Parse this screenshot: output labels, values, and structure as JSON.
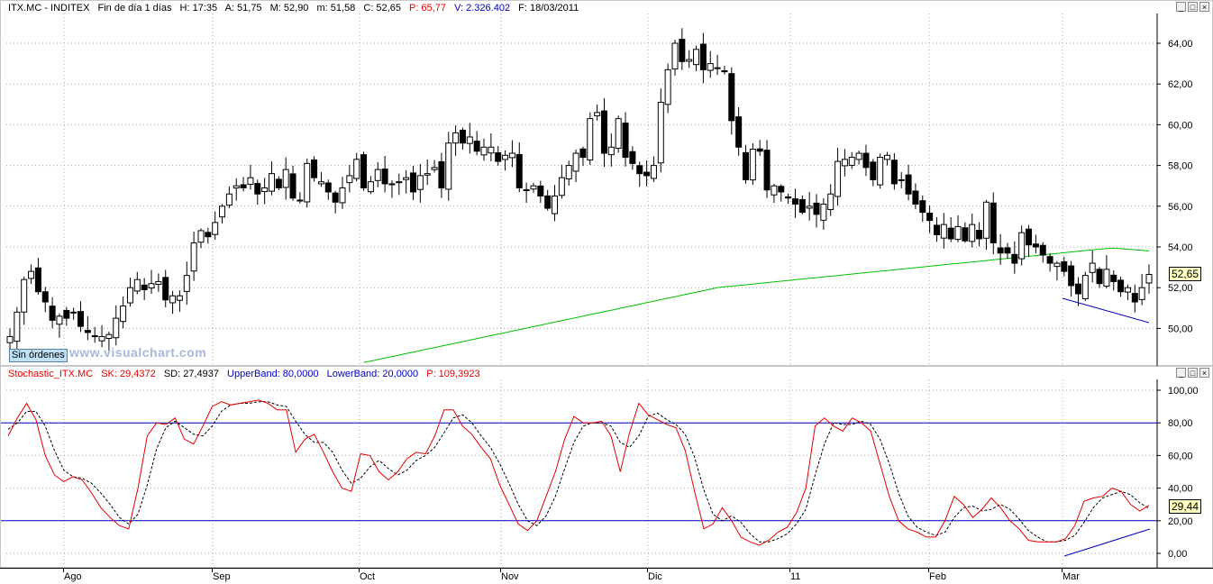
{
  "price_header": {
    "symbol": "ITX.MC - INDITEX",
    "period": "Fin de día 1 días",
    "h": "H: 17:35",
    "a": "A: 51,75",
    "m": "M: 52,90",
    "min": "m: 51,58",
    "c": "C: 52,65",
    "p": "P: 65,77",
    "v": "V: 2.326.402",
    "f": "F: 18/03/2011"
  },
  "stoch_header": {
    "name": "Stochastic_ITX.MC",
    "sk": "SK: 29,4372",
    "sd": "SD: 27,4937",
    "upper": "UpperBand: 80,0000",
    "lower": "LowerBand: 20,0000",
    "p": "P: 109,3923"
  },
  "window_buttons": {
    "min": "_",
    "max": "□",
    "close": "×"
  },
  "sin_ordenes": "Sin órdenes",
  "watermark": "www.visualchart.com",
  "last_price": "52,65",
  "last_stoch": "29,44",
  "price_axis": [
    "64,00",
    "62,00",
    "60,00",
    "58,00",
    "56,00",
    "54,00",
    "52,00",
    "50,00"
  ],
  "stoch_axis": [
    "100,00",
    "80,00",
    "60,00",
    "40,00",
    "20,00",
    "0,00"
  ],
  "months": [
    "Ago",
    "Sep",
    "Oct",
    "Nov",
    "Dic",
    "11",
    "Feb",
    "Mar"
  ],
  "colors": {
    "ma": "#00c000",
    "sk": "#e00000",
    "sd": "#000000",
    "band": "#0000c0",
    "trend": "#0000c0"
  },
  "chart_data": [
    {
      "type": "candlestick",
      "title": "ITX.MC - INDITEX",
      "ylim": [
        48.2,
        65.0
      ],
      "x": [
        "Ago",
        "Sep",
        "Oct",
        "Nov",
        "Dic",
        "11",
        "Feb",
        "Mar"
      ],
      "close": [
        49.6,
        50.8,
        52.4,
        52.8,
        51.8,
        51.3,
        50.4,
        50.6,
        50.5,
        50.8,
        50.1,
        49.8,
        49.6,
        49.6,
        49.7,
        50.5,
        51.1,
        52.0,
        52.4,
        51.9,
        52.2,
        52.3,
        51.4,
        51.6,
        51.6,
        52.6,
        54.2,
        54.8,
        54.5,
        55.2,
        56.0,
        56.6,
        57.0,
        56.9,
        57.4,
        56.6,
        56.9,
        57.6,
        56.9,
        57.8,
        56.4,
        56.3,
        58.1,
        57.4,
        57.2,
        56.7,
        56.2,
        56.9,
        57.5,
        58.3,
        56.9,
        57.2,
        57.8,
        57.1,
        57.1,
        57.2,
        57.4,
        56.7,
        57.5,
        57.6,
        57.9,
        56.9,
        59.1,
        59.6,
        59.1,
        59.4,
        58.7,
        58.9,
        58.9,
        58.2,
        58.5,
        58.6,
        56.9,
        56.8,
        57.0,
        56.5,
        55.9,
        56.5,
        57.4,
        58.0,
        58.6,
        58.4,
        60.3,
        60.6,
        58.6,
        58.9,
        60.3,
        58.4,
        58.1,
        57.6,
        57.5,
        58.0,
        61.1,
        62.7,
        64.0,
        63.1,
        63.2,
        63.7,
        62.7,
        63.0,
        62.8,
        62.6,
        60.2,
        58.9,
        57.3,
        58.8,
        58.7,
        56.8,
        57.0,
        56.7,
        56.4,
        56.1,
        55.7,
        56.0,
        55.6,
        56.1,
        56.6,
        58.2,
        58.3,
        58.4,
        58.6,
        57.9,
        57.3,
        58.4,
        58.5,
        57.1,
        57.3,
        56.6,
        56.1,
        55.7,
        55.3,
        54.6,
        55.1,
        54.4,
        55.0,
        54.3,
        55.1,
        54.4,
        56.2,
        54.2,
        53.7,
        53.7,
        53.2,
        54.7,
        54.1,
        54.0,
        53.6,
        53.2,
        53.2,
        52.8,
        52.1,
        51.7,
        52.6,
        53.2,
        52.2,
        52.9,
        52.3,
        51.8,
        52.0,
        51.3,
        52.0,
        52.65
      ]
    },
    {
      "type": "line",
      "title": "Stochastic_ITX.MC",
      "ylim": [
        -8,
        106
      ],
      "series": [
        {
          "name": "SK",
          "values": [
            72,
            83,
            92,
            82,
            60,
            48,
            44,
            47,
            45,
            37,
            28,
            22,
            17,
            15,
            40,
            72,
            80,
            79,
            83,
            70,
            67,
            78,
            90,
            93,
            91,
            92,
            93,
            94,
            92,
            88,
            88,
            62,
            70,
            73,
            62,
            50,
            40,
            38,
            61,
            60,
            50,
            45,
            50,
            58,
            62,
            61,
            72,
            88,
            88,
            78,
            73,
            65,
            58,
            42,
            30,
            18,
            14,
            20,
            35,
            50,
            70,
            84,
            80,
            80,
            81,
            72,
            50,
            74,
            92,
            85,
            82,
            79,
            77,
            63,
            38,
            15,
            18,
            28,
            20,
            10,
            7,
            5,
            8,
            13,
            16,
            25,
            40,
            78,
            83,
            78,
            75,
            83,
            80,
            75,
            55,
            35,
            20,
            15,
            13,
            10,
            10,
            20,
            35,
            30,
            22,
            27,
            34,
            28,
            20,
            15,
            8,
            7,
            7,
            7,
            9,
            17,
            32,
            34,
            35,
            40,
            38,
            30,
            26,
            29.4
          ]
        },
        {
          "name": "SD",
          "values": [
            76,
            80,
            87,
            87,
            78,
            63,
            51,
            47,
            46,
            43,
            37,
            30,
            22,
            18,
            24,
            42,
            64,
            77,
            81,
            77,
            73,
            72,
            78,
            87,
            91,
            92,
            92,
            93,
            93,
            91,
            90,
            81,
            73,
            68,
            68,
            62,
            51,
            43,
            46,
            53,
            57,
            52,
            48,
            51,
            57,
            60,
            65,
            74,
            83,
            85,
            80,
            72,
            65,
            55,
            43,
            30,
            20,
            17,
            23,
            35,
            52,
            68,
            78,
            80,
            80,
            78,
            68,
            65,
            72,
            84,
            86,
            82,
            79,
            73,
            59,
            39,
            24,
            20,
            23,
            19,
            12,
            7,
            7,
            9,
            12,
            18,
            27,
            48,
            67,
            80,
            79,
            79,
            81,
            79,
            70,
            55,
            37,
            23,
            16,
            13,
            11,
            13,
            22,
            28,
            29,
            26,
            27,
            30,
            27,
            21,
            14,
            10,
            7,
            7,
            8,
            11,
            19,
            28,
            34,
            36,
            38,
            36,
            31,
            27.5
          ]
        },
        {
          "name": "UpperBand",
          "values": [
            80
          ]
        },
        {
          "name": "LowerBand",
          "values": [
            20
          ]
        }
      ]
    }
  ]
}
